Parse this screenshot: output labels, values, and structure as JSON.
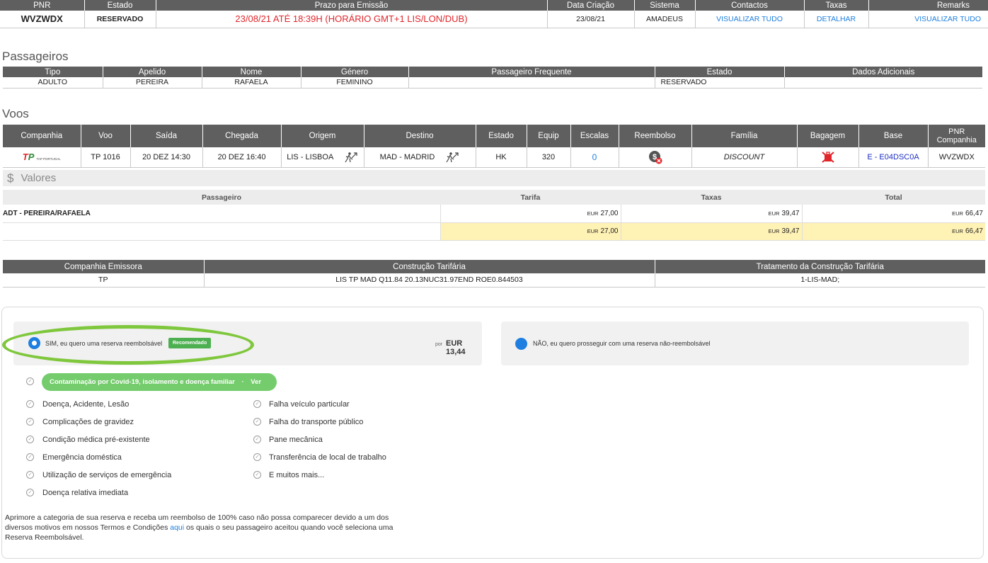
{
  "pnr_table": {
    "headers": [
      "PNR",
      "Estado",
      "Prazo para Emissão",
      "Data Criação",
      "Sistema",
      "Contactos",
      "Taxas",
      "Remarks"
    ],
    "pnr": "WVZWDX",
    "estado": "RESERVADO",
    "prazo": "23/08/21 ATÉ 18:39H (HORÁRIO GMT+1 LIS/LON/DUB)",
    "data_criacao": "23/08/21",
    "sistema": "AMADEUS",
    "contactos_link": "VISUALIZAR TUDO",
    "taxas_link": "DETALHAR",
    "remarks_link": "VISUALIZAR TUDO"
  },
  "passengers": {
    "title": "Passageiros",
    "headers": [
      "Tipo",
      "Apelido",
      "Nome",
      "Género",
      "Passageiro Frequente",
      "Estado",
      "Dados Adicionais"
    ],
    "row": [
      "ADULTO",
      "PEREIRA",
      "RAFAELA",
      "FEMININO",
      "",
      "RESERVADO",
      ""
    ]
  },
  "flights": {
    "title": "Voos",
    "headers": [
      "Companhia",
      "Voo",
      "Saída",
      "Chegada",
      "Origem",
      "Destino",
      "Estado",
      "Equip",
      "Escalas",
      "Reembolso",
      "Família",
      "Bagagem",
      "Base",
      "PNR Companhia"
    ],
    "airline_logo": "TAP PORTUGAL",
    "voo": "TP 1016",
    "saida": "20 DEZ 14:30",
    "chegada": "20 DEZ 16:40",
    "origem": "LIS - LISBOA",
    "destino": "MAD - MADRID",
    "estado": "HK",
    "equip": "320",
    "escalas": "0",
    "familia": "DISCOUNT",
    "base": "E - E04DSC0A",
    "pnr_companhia": "WVZWDX",
    "icons": {
      "origem": "departure-icon",
      "destino": "departure-icon",
      "reembolso": "no-refund-icon",
      "bagagem": "no-baggage-icon"
    }
  },
  "valores": {
    "title": "Valores",
    "headers": [
      "Passageiro",
      "Tarifa",
      "Taxas",
      "Total"
    ],
    "currency": "EUR",
    "rows": [
      {
        "passenger": "ADT - PEREIRA/RAFAELA",
        "tarifa": "27,00",
        "taxas": "39,47",
        "total": "66,47"
      },
      {
        "passenger": "",
        "tarifa": "27,00",
        "taxas": "39,47",
        "total": "66,47"
      }
    ]
  },
  "tarifaria": {
    "headers": [
      "Companhia Emissora",
      "Construção Tarifária",
      "Tratamento da Construção Tarifária"
    ],
    "row": [
      "TP",
      "LIS TP MAD Q11.84 20.13NUC31.97END ROE0.844503",
      "1-LIS-MAD;"
    ]
  },
  "refund": {
    "yes_label": "SIM, eu quero uma reserva reembolsável",
    "badge": "Recomendado",
    "price_prefix": "por",
    "price": "EUR 13,44",
    "no_label": "NÃO, eu quero prosseguir com uma reserva não-reembolsável",
    "covid": "Contaminação por Covid-19, isolamento e doença familiar",
    "covid_sep": "·",
    "covid_link": "Ver detalhes",
    "left_items": [
      "Doença, Acidente, Lesão",
      "Complicações de gravidez",
      "Condição médica pré-existente",
      "Emergência doméstica",
      "Utilização de serviços de emergência",
      "Doença relativa imediata"
    ],
    "right_items": [
      "Falha veículo particular",
      "Falha do transporte público",
      "Pane mecânica",
      "Transferência de local de trabalho"
    ],
    "more_link": "E muitos mais...",
    "para_1": "Aprimore a categoria de sua reserva e receba um reembolso de 100% caso não possa comparecer devido a um dos diversos motivos em nossos Termos e Condições",
    "para_link": "aqui",
    "para_2": "os quais o seu passageiro aceitou quando você seleciona uma Reserva Reembolsável."
  },
  "colors": {
    "header_bg": "#5f5f5f",
    "alert_red": "#e0262b",
    "link_blue": "#1e7fe0",
    "highlight_yellow": "#fff2b5",
    "ellipse_green": "#7fc73d",
    "pill_green": "#74cc6c",
    "radio_blue": "#1e7fe0"
  }
}
